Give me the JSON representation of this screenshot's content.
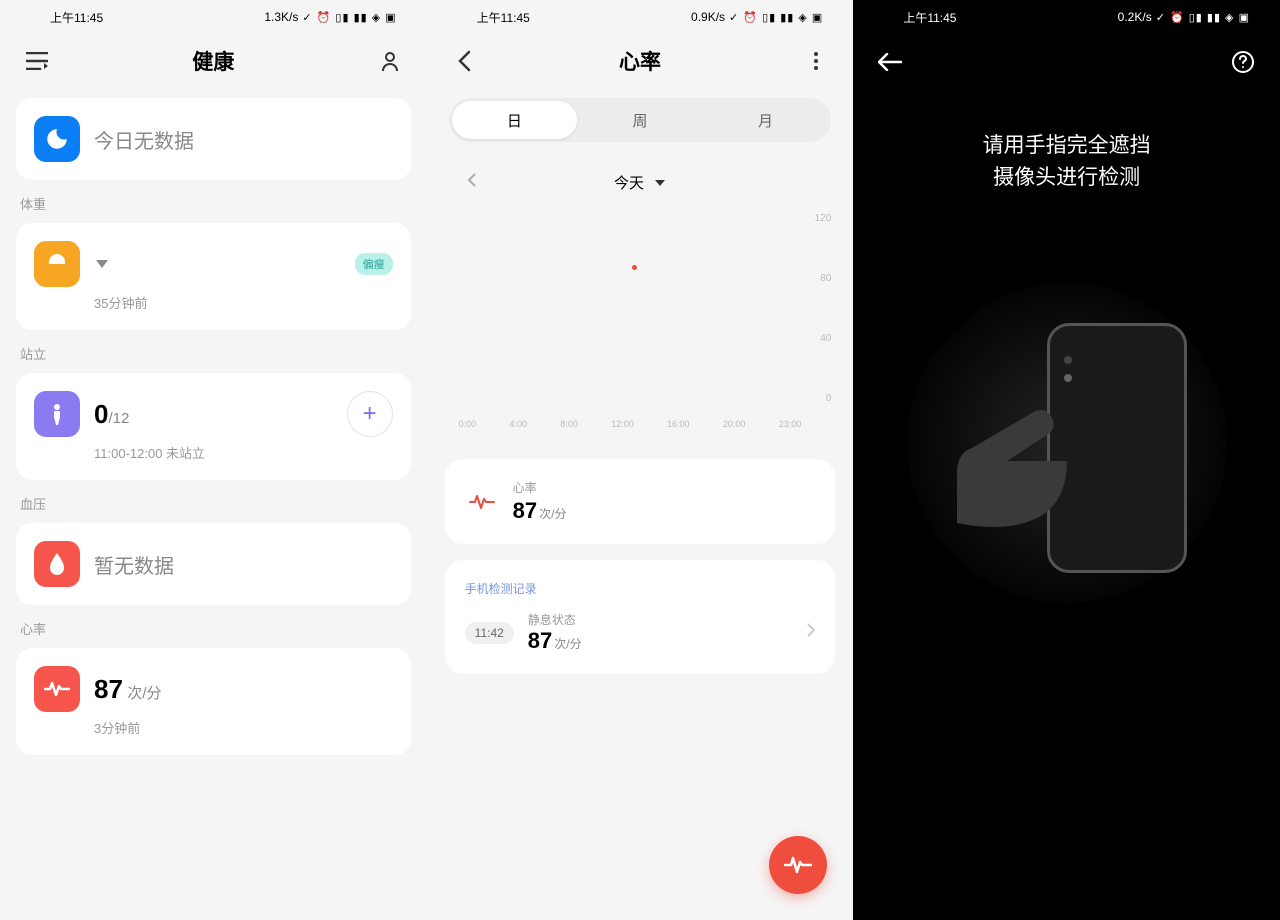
{
  "status": {
    "time": "上午11:45",
    "net1": "1.3K/s",
    "net2": "0.9K/s",
    "net3": "0.2K/s",
    "icons": "⏰ ⊡ ▯ ⫴ ⫴ ⫴ ▯ ⚡"
  },
  "screen1": {
    "title": "健康",
    "today_card": "今日无数据",
    "sections": {
      "weight": {
        "label": "体重",
        "timeago": "35分钟前",
        "badge": "偏瘦"
      },
      "stand": {
        "label": "站立",
        "value": "0",
        "suffix": "/12",
        "sub": "11:00-12:00 未站立"
      },
      "blood": {
        "label": "血压",
        "text": "暂无数据"
      },
      "heart": {
        "label": "心率",
        "value": "87",
        "unit": "次/分",
        "sub": "3分钟前"
      }
    }
  },
  "screen2": {
    "title": "心率",
    "segments": [
      "日",
      "周",
      "月"
    ],
    "date_label": "今天",
    "current": {
      "label": "心率",
      "value": "87",
      "unit": "次/分"
    },
    "records_header": "手机检测记录",
    "record": {
      "time": "11:42",
      "state": "静息状态",
      "value": "87",
      "unit": "次/分"
    }
  },
  "screen3": {
    "instruction": "请用手指完全遮挡\n摄像头进行检测"
  },
  "chart_data": {
    "type": "scatter",
    "title": "",
    "xlabel": "",
    "ylabel": "",
    "x_ticks": [
      "0:00",
      "4:00",
      "8:00",
      "12:00",
      "16:00",
      "20:00",
      "23:00"
    ],
    "y_ticks": [
      0,
      40,
      80,
      120
    ],
    "ylim": [
      0,
      120
    ],
    "series": [
      {
        "name": "心率",
        "x": [
          "11:42"
        ],
        "y": [
          87
        ]
      }
    ]
  }
}
